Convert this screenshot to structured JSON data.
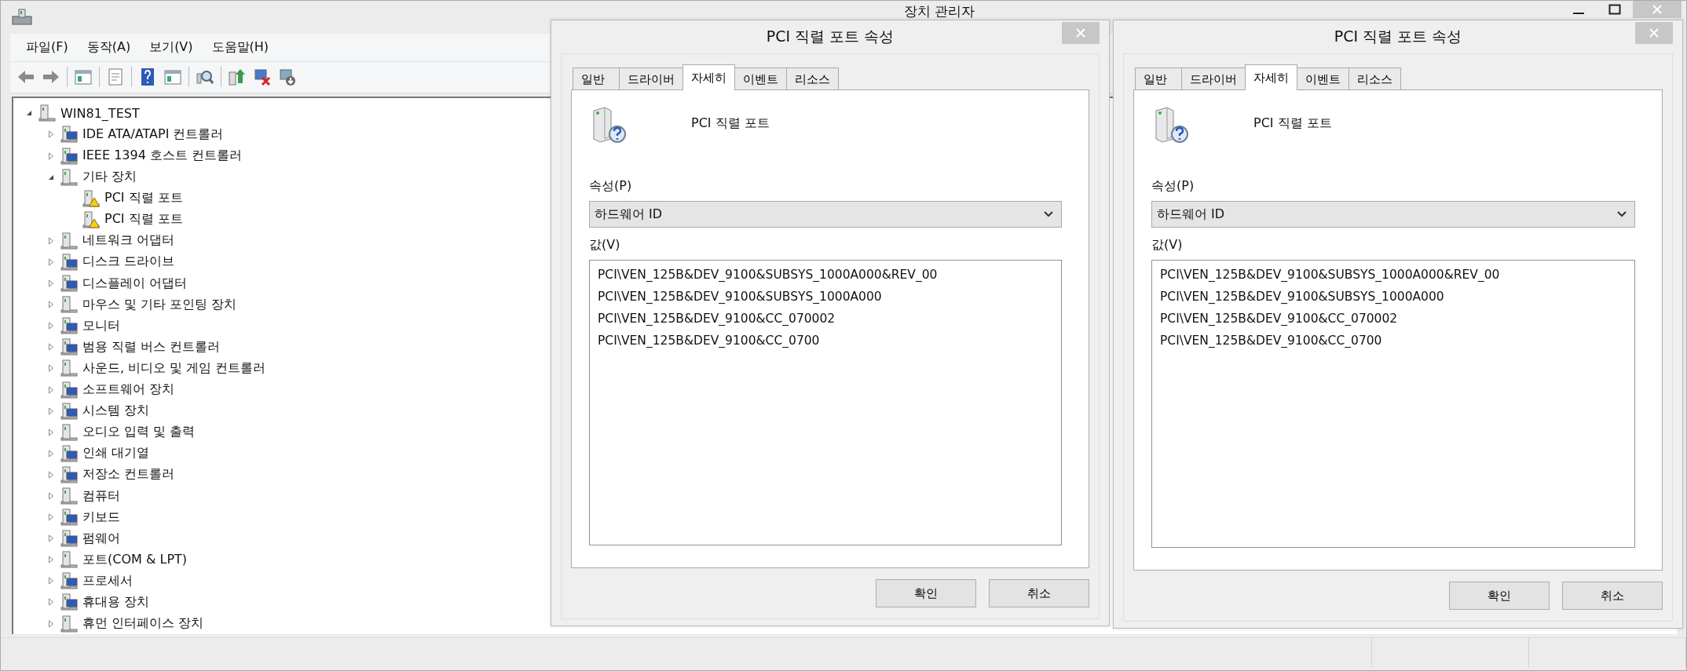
{
  "main_window": {
    "title": "장치 관리자",
    "menu": [
      "파일(F)",
      "동작(A)",
      "보기(V)",
      "도움말(H)"
    ],
    "tree": [
      {
        "label": "WIN81_TEST",
        "expanded": true,
        "children": [
          {
            "label": "IDE ATA/ATAPI 컨트롤러",
            "expanded": false
          },
          {
            "label": "IEEE 1394 호스트 컨트롤러",
            "expanded": false
          },
          {
            "label": "기타 장치",
            "expanded": true,
            "children": [
              {
                "label": "PCI 직렬 포트",
                "warning": true
              },
              {
                "label": "PCI 직렬 포트",
                "warning": true
              }
            ]
          },
          {
            "label": "네트워크 어댑터",
            "expanded": false
          },
          {
            "label": "디스크 드라이브",
            "expanded": false
          },
          {
            "label": "디스플레이 어댑터",
            "expanded": false
          },
          {
            "label": "마우스 및 기타 포인팅 장치",
            "expanded": false
          },
          {
            "label": "모니터",
            "expanded": false
          },
          {
            "label": "범용 직렬 버스 컨트롤러",
            "expanded": false
          },
          {
            "label": "사운드, 비디오 및 게임 컨트롤러",
            "expanded": false
          },
          {
            "label": "소프트웨어 장치",
            "expanded": false
          },
          {
            "label": "시스템 장치",
            "expanded": false
          },
          {
            "label": "오디오 입력 및 출력",
            "expanded": false
          },
          {
            "label": "인쇄 대기열",
            "expanded": false
          },
          {
            "label": "저장소 컨트롤러",
            "expanded": false
          },
          {
            "label": "컴퓨터",
            "expanded": false
          },
          {
            "label": "키보드",
            "expanded": false
          },
          {
            "label": "펌웨어",
            "expanded": false
          },
          {
            "label": "포트(COM & LPT)",
            "expanded": false
          },
          {
            "label": "프로세서",
            "expanded": false
          },
          {
            "label": "휴대용 장치",
            "expanded": false
          },
          {
            "label": "휴먼 인터페이스 장치",
            "expanded": false
          }
        ]
      }
    ]
  },
  "dialogs": [
    {
      "title": "PCI 직렬 포트 속성",
      "tabs": [
        {
          "label": "일반",
          "selected": false
        },
        {
          "label": "드라이버",
          "selected": false
        },
        {
          "label": "자세히",
          "selected": true
        },
        {
          "label": "이벤트",
          "selected": false
        },
        {
          "label": "리소스",
          "selected": false
        }
      ],
      "device_name": "PCI 직렬 포트",
      "property_label": "속성(P)",
      "property_value": "하드웨어 ID",
      "value_label": "값(V)",
      "values": [
        "PCI\\VEN_125B&DEV_9100&SUBSYS_1000A000&REV_00",
        "PCI\\VEN_125B&DEV_9100&SUBSYS_1000A000",
        "PCI\\VEN_125B&DEV_9100&CC_070002",
        "PCI\\VEN_125B&DEV_9100&CC_0700"
      ],
      "buttons": [
        "확인",
        "취소"
      ]
    },
    {
      "title": "PCI 직렬 포트 속성",
      "tabs": [
        {
          "label": "일반",
          "selected": false
        },
        {
          "label": "드라이버",
          "selected": false
        },
        {
          "label": "자세히",
          "selected": true
        },
        {
          "label": "이벤트",
          "selected": false
        },
        {
          "label": "리소스",
          "selected": false
        }
      ],
      "device_name": "PCI 직렬 포트",
      "property_label": "속성(P)",
      "property_value": "하드웨어 ID",
      "value_label": "값(V)",
      "values": [
        "PCI\\VEN_125B&DEV_9100&SUBSYS_1000A000&REV_00",
        "PCI\\VEN_125B&DEV_9100&SUBSYS_1000A000",
        "PCI\\VEN_125B&DEV_9100&CC_070002",
        "PCI\\VEN_125B&DEV_9100&CC_0700"
      ],
      "buttons": [
        "확인",
        "취소"
      ]
    }
  ]
}
